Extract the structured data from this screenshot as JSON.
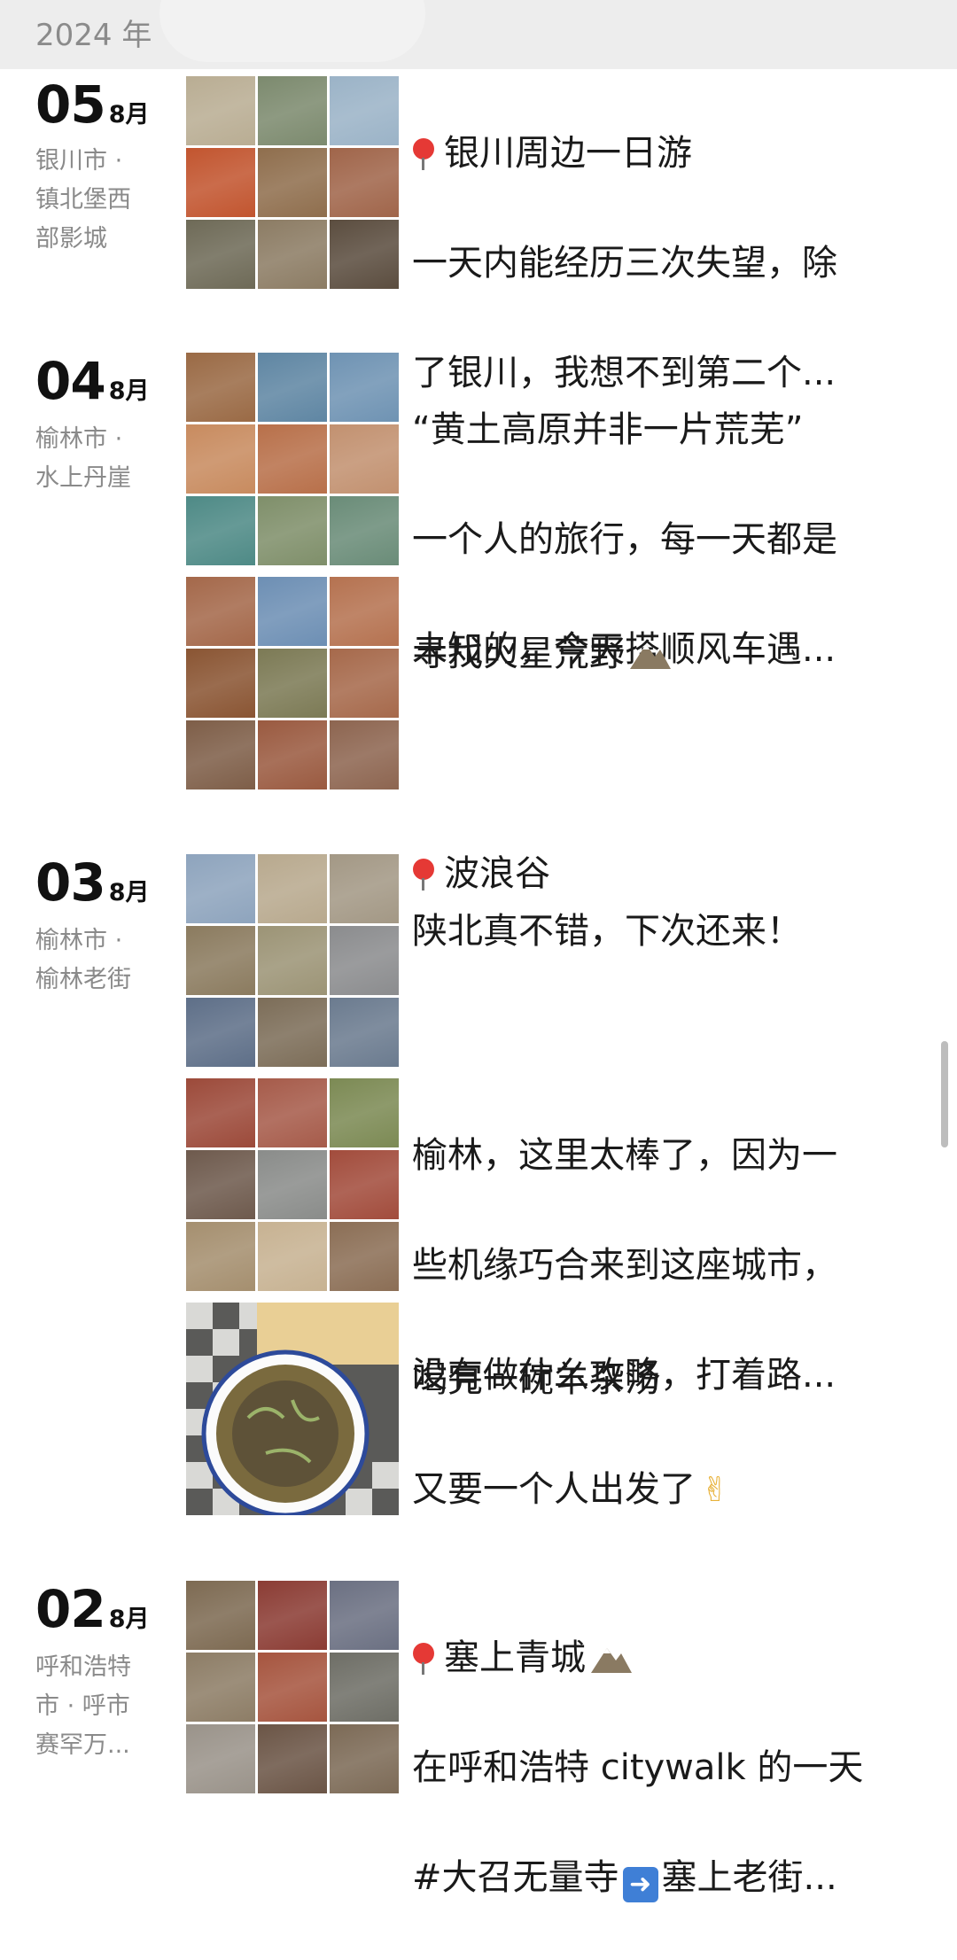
{
  "header": {
    "year": "2024 年"
  },
  "colors": {
    "pin": "#e53935",
    "muted": "#8a8a8a",
    "text": "#1a1a1a"
  },
  "entries": [
    {
      "day": "05",
      "month": "8月",
      "location_lines": [
        "银川市 ·",
        "镇北堡西",
        "部影城"
      ],
      "posts": [
        {
          "type": "grid",
          "photo_colors": [
            "#b9ad93",
            "#7c8a6e",
            "#9bb3c7",
            "#c2552f",
            "#8f6e4d",
            "#a0654a",
            "#6e6a57",
            "#8c7c64",
            "#5b4d3f"
          ],
          "icon": "map-pin-icon",
          "lines": [
            "银川周边一日游",
            "一天内能经历三次失望，除",
            "了银川，我想不到第二个..."
          ]
        }
      ]
    },
    {
      "day": "04",
      "month": "8月",
      "location_lines": [
        "榆林市 ·",
        "水上丹崖"
      ],
      "posts": [
        {
          "type": "grid",
          "photo_colors": [
            "#9a6a45",
            "#5f86a3",
            "#6f93b3",
            "#c88b5f",
            "#b8704a",
            "#c29170",
            "#4e8a86",
            "#7f8f6a",
            "#6a8c78"
          ],
          "lines": [
            "“黄土高原并非一片荒芜”",
            "一个人的旅行，每一天都是",
            "未知的，今天搭顺风车遇..."
          ]
        },
        {
          "type": "grid",
          "photo_colors": [
            "#a4684a",
            "#6d8fb4",
            "#b57250",
            "#8a5533",
            "#7c7a55",
            "#a6694b",
            "#7e5e48",
            "#9a5a40",
            "#8d6550"
          ],
          "icon": "mountain-icon",
          "lines": [
            "寻找火星荒野",
            "",
            "波浪谷"
          ]
        }
      ]
    },
    {
      "day": "03",
      "month": "8月",
      "location_lines": [
        "榆林市 ·",
        "榆林老街"
      ],
      "posts": [
        {
          "type": "grid",
          "photo_colors": [
            "#8ea4bd",
            "#b8a98e",
            "#a39885",
            "#8b7b5f",
            "#9c9476",
            "#8b8c8e",
            "#5e6f88",
            "#7c6d58",
            "#6b7b8f"
          ],
          "lines": [
            "陕北真不错，下次还来！"
          ]
        },
        {
          "type": "grid",
          "photo_colors": [
            "#9c4a3a",
            "#a65b4a",
            "#7c8a54",
            "#6e5a4d",
            "#8a8c8a",
            "#a24c3c",
            "#a58f6f",
            "#c7b292",
            "#8b6e55"
          ],
          "lines": [
            "榆林，这里太棒了，因为一",
            "些机缘巧合来到这座城市，",
            "没有做什么攻略，打着路..."
          ]
        },
        {
          "type": "single",
          "photo_colors": [
            "#6e6a4a"
          ],
          "icon": "victory-hand-icon",
          "lines": [
            "喝完一碗羊杂汤",
            "又要一个人出发了"
          ]
        }
      ]
    },
    {
      "day": "02",
      "month": "8月",
      "location_lines": [
        "呼和浩特",
        "市 · 呼市",
        "赛罕万..."
      ],
      "posts": [
        {
          "type": "grid",
          "photo_colors": [
            "#7d6a52",
            "#8b3c34",
            "#6b7082",
            "#8d7d66",
            "#a6553f",
            "#6e6e66",
            "#9a938a",
            "#6b5546",
            "#7c6a56"
          ],
          "icon": "map-pin-icon",
          "icon2": "mountain-icon",
          "icon3": "right-arrow-icon",
          "lines": [
            "塞上青城",
            "在呼和浩特 citywalk 的一天",
            "#大召无量寺",
            "塞上老街..."
          ]
        }
      ]
    }
  ]
}
